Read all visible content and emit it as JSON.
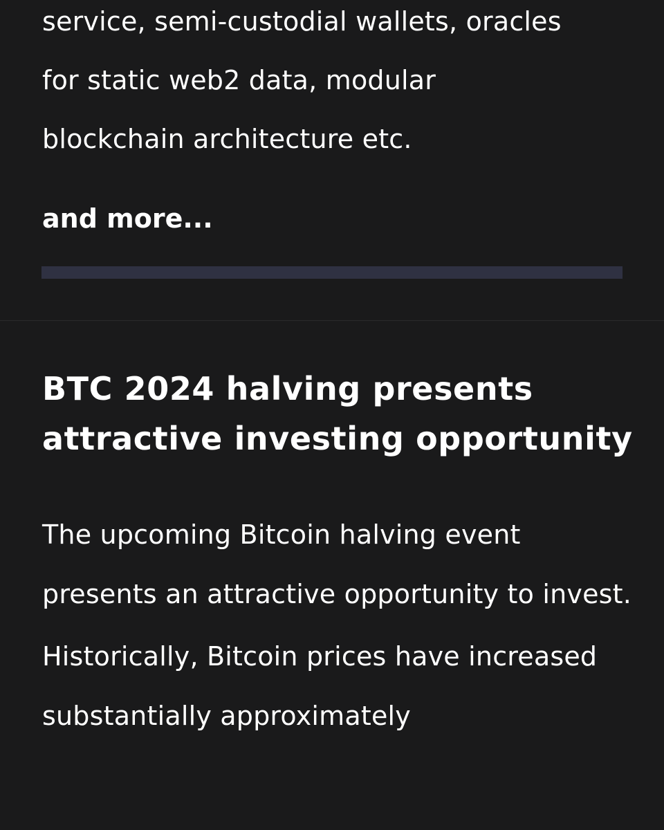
{
  "previous_section": {
    "paragraph_tail_lines": [
      "service, semi-custodial wallets, oracles",
      "for static web2 data, modular",
      "blockchain architecture etc."
    ],
    "and_more_label": "and more..."
  },
  "article": {
    "title": "BTC 2024 halving presents attractive investing opportunity",
    "paragraphs": [
      "The upcoming Bitcoin halving event presents an attractive opportunity to invest.",
      "Historically, Bitcoin prices have increased substantially approximately"
    ]
  },
  "colors": {
    "background": "#1a1a1b",
    "text": "#ffffff",
    "track": "#2f3142"
  }
}
